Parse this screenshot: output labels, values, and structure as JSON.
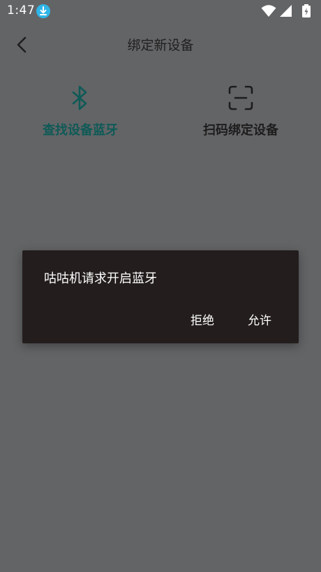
{
  "status_bar": {
    "time": "1:47",
    "download_icon": "download-icon",
    "wifi_icon": "wifi-icon",
    "signal_icon": "cell-signal-icon",
    "battery_icon": "battery-charging-icon"
  },
  "app_bar": {
    "back_icon": "chevron-left-icon",
    "title": "绑定新设备"
  },
  "tabs": [
    {
      "icon": "bluetooth-icon",
      "label": "查找设备蓝牙",
      "active": true,
      "color": "#0e5a57"
    },
    {
      "icon": "scan-frame-icon",
      "label": "扫码绑定设备",
      "active": false,
      "color": "#1d1d1d"
    }
  ],
  "dialog": {
    "message": "咕咕机请求开启蓝牙",
    "deny_label": "拒绝",
    "allow_label": "允许"
  },
  "colors": {
    "scrim_background": "#636466",
    "dialog_background": "#231d1d",
    "accent": "#0e5a57",
    "download_badge": "#2fb5e8"
  }
}
